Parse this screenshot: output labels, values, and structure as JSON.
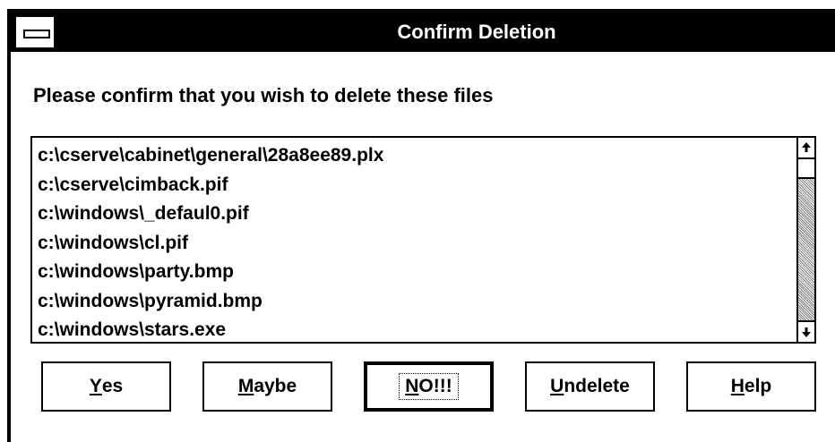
{
  "dialog": {
    "title": "Confirm Deletion",
    "prompt": "Please confirm that you wish to delete these files"
  },
  "files": [
    "c:\\cserve\\cabinet\\general\\28a8ee89.plx",
    "c:\\cserve\\cimback.pif",
    "c:\\windows\\_defaul0.pif",
    "c:\\windows\\cl.pif",
    "c:\\windows\\party.bmp",
    "c:\\windows\\pyramid.bmp",
    "c:\\windows\\stars.exe"
  ],
  "buttons": {
    "yes": {
      "accel": "Y",
      "rest": "es"
    },
    "maybe": {
      "accel": "M",
      "rest": "aybe"
    },
    "no": {
      "accel": "N",
      "rest": "O!!!"
    },
    "undelete": {
      "accel": "U",
      "rest": "ndelete"
    },
    "help": {
      "accel": "H",
      "rest": "elp"
    }
  },
  "icons": {
    "system_menu": "system-menu-icon",
    "scroll_up": "arrow-up-icon",
    "scroll_down": "arrow-down-icon"
  },
  "colors": {
    "titlebar": "#000000",
    "title_text": "#ffffff",
    "window_bg": "#ffffff",
    "scroll_track": "#c0c0c0"
  }
}
